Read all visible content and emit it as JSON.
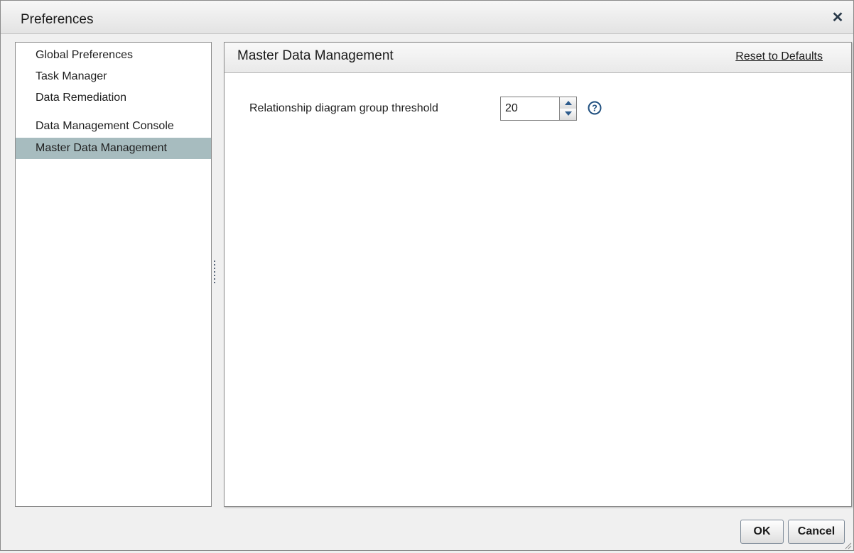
{
  "window": {
    "title": "Preferences",
    "close_icon": "close-icon"
  },
  "nav": {
    "items": [
      {
        "label": "Global Preferences",
        "selected": false
      },
      {
        "label": "Task Manager",
        "selected": false
      },
      {
        "label": "Data Remediation",
        "selected": false
      },
      {
        "label": "Data Management Console",
        "selected": false
      },
      {
        "label": "Master Data Management",
        "selected": true
      }
    ],
    "selected_color": "#a7bcbf"
  },
  "content": {
    "title": "Master Data Management",
    "reset_label": "Reset to Defaults",
    "field": {
      "label": "Relationship diagram group threshold",
      "value": "20",
      "help_icon": "help-icon"
    }
  },
  "footer": {
    "ok_label": "OK",
    "cancel_label": "Cancel"
  }
}
